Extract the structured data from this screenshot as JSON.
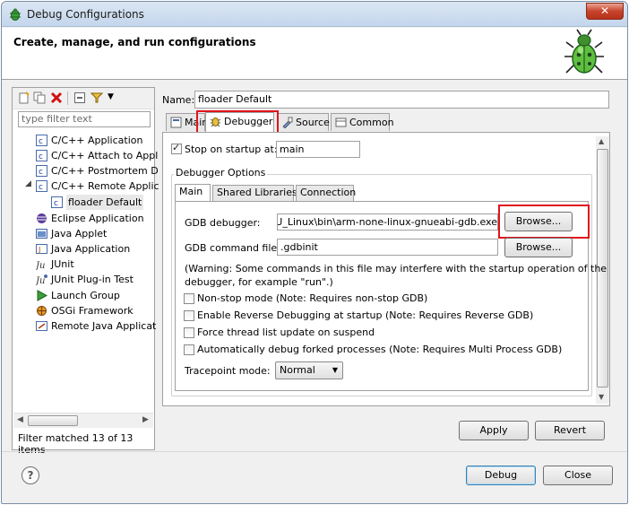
{
  "window": {
    "title": "Debug Configurations",
    "close_glyph": "✕"
  },
  "banner": {
    "heading": "Create, manage, and run configurations"
  },
  "left": {
    "filter_placeholder": "type filter text",
    "tree": [
      {
        "label": "C/C++ Application",
        "icon": "c-app-icon"
      },
      {
        "label": "C/C++ Attach to Appl",
        "icon": "c-app-icon"
      },
      {
        "label": "C/C++ Postmortem D",
        "icon": "c-app-icon"
      },
      {
        "label": "C/C++ Remote Applic",
        "icon": "c-app-icon"
      },
      {
        "label": "floader Default",
        "icon": "c-app-icon"
      },
      {
        "label": "Eclipse Application",
        "icon": "eclipse-icon"
      },
      {
        "label": "Java Applet",
        "icon": "applet-icon"
      },
      {
        "label": "Java Application",
        "icon": "java-app-icon"
      },
      {
        "label": "JUnit",
        "icon": "junit-icon"
      },
      {
        "label": "JUnit Plug-in Test",
        "icon": "junit-plugin-icon"
      },
      {
        "label": "Launch Group",
        "icon": "launch-group-icon"
      },
      {
        "label": "OSGi Framework",
        "icon": "osgi-icon"
      },
      {
        "label": "Remote Java Applicat",
        "icon": "remote-java-icon"
      }
    ],
    "filter_status": "Filter matched 13 of 13 items"
  },
  "config": {
    "name_label": "Name:",
    "name_value": "floader Default",
    "tabs": [
      {
        "label": "Main"
      },
      {
        "label": "Debugger"
      },
      {
        "label": "Source"
      },
      {
        "label": "Common"
      }
    ],
    "stop_on_startup_label": "Stop on startup at:",
    "stop_on_startup_value": "main",
    "debugger_options_title": "Debugger Options",
    "subtabs": [
      {
        "label": "Main"
      },
      {
        "label": "Shared Libraries"
      },
      {
        "label": "Connection"
      }
    ],
    "gdb_debugger_label": "GDB debugger:",
    "gdb_debugger_value": "GNU_Linux\\bin\\arm-none-linux-gnueabi-gdb.exe",
    "gdb_command_file_label": "GDB command file:",
    "gdb_command_file_value": ".gdbinit",
    "browse_label": "Browse...",
    "warning_line1": "(Warning: Some commands in this file may interfere with the startup operation of the",
    "warning_line2": "debugger, for example \"run\".)",
    "options": [
      {
        "label": "Non-stop mode (Note: Requires non-stop GDB)"
      },
      {
        "label": "Enable Reverse Debugging at startup (Note: Requires Reverse GDB)"
      },
      {
        "label": "Force thread list update on suspend"
      },
      {
        "label": "Automatically debug forked processes (Note: Requires Multi Process GDB)"
      }
    ],
    "tracepoint_label": "Tracepoint mode:",
    "tracepoint_value": "Normal"
  },
  "buttons": {
    "apply": "Apply",
    "revert": "Revert",
    "debug": "Debug",
    "close": "Close",
    "help": "?"
  },
  "colors": {
    "highlight_box": "#e0141b"
  }
}
